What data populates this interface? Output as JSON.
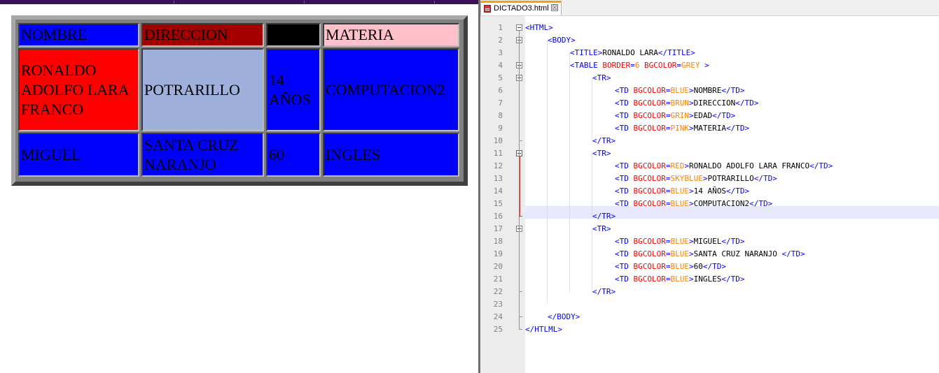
{
  "browser": {
    "table": {
      "rows": [
        [
          {
            "text": "NOMBRE",
            "bg": "#0000ff"
          },
          {
            "text": "DIRECCION",
            "bg": "#a50000"
          },
          {
            "text": "",
            "bg": "#000000"
          },
          {
            "text": "MATERIA",
            "bg": "#ffc0cb"
          }
        ],
        [
          {
            "text": "RONALDO ADOLFO LARA FRANCO",
            "bg": "#ff0000"
          },
          {
            "text": "POTRARILLO",
            "bg": "#9fb0dc"
          },
          {
            "text": "14 AÑOS",
            "bg": "#0000ff"
          },
          {
            "text": "COMPUTACION2",
            "bg": "#0000ff"
          }
        ],
        [
          {
            "text": "MIGUEL",
            "bg": "#0000ff"
          },
          {
            "text": "SANTA CRUZ NARANJO",
            "bg": "#0000ff"
          },
          {
            "text": "60",
            "bg": "#0000ff"
          },
          {
            "text": "INGLES",
            "bg": "#0000ff"
          }
        ]
      ]
    }
  },
  "editor": {
    "tab": {
      "label": "DICTADO3.html",
      "close": "☒"
    },
    "current_line": 16,
    "lines": [
      [
        [
          "tag",
          "<HTML>"
        ]
      ],
      [
        [
          "tag",
          "<BODY>"
        ]
      ],
      [
        [
          "tag",
          "<TITLE>"
        ],
        [
          "text",
          "RONALDO LARA"
        ],
        [
          "tag",
          "</TITLE>"
        ]
      ],
      [
        [
          "tag",
          "<TABLE "
        ],
        [
          "attr",
          "BORDER"
        ],
        [
          "tag",
          "="
        ],
        [
          "val",
          "6 "
        ],
        [
          "attr",
          "BGCOLOR"
        ],
        [
          "tag",
          "="
        ],
        [
          "val",
          "GREY "
        ],
        [
          "tag",
          ">"
        ]
      ],
      [
        [
          "tag",
          "<TR>"
        ]
      ],
      [
        [
          "tag",
          "<TD "
        ],
        [
          "attr",
          "BGCOLOR"
        ],
        [
          "tag",
          "="
        ],
        [
          "val",
          "BLUE"
        ],
        [
          "tag",
          ">"
        ],
        [
          "text",
          "NOMBRE"
        ],
        [
          "tag",
          "</TD>"
        ]
      ],
      [
        [
          "tag",
          "<TD "
        ],
        [
          "attr",
          "BGCOLOR"
        ],
        [
          "tag",
          "="
        ],
        [
          "val",
          "BRUN"
        ],
        [
          "tag",
          ">"
        ],
        [
          "text",
          "DIRECCION"
        ],
        [
          "tag",
          "</TD>"
        ]
      ],
      [
        [
          "tag",
          "<TD "
        ],
        [
          "attr",
          "BGCOLOR"
        ],
        [
          "tag",
          "="
        ],
        [
          "val",
          "GRIN"
        ],
        [
          "tag",
          ">"
        ],
        [
          "text",
          "EDAD"
        ],
        [
          "tag",
          "</TD>"
        ]
      ],
      [
        [
          "tag",
          "<TD "
        ],
        [
          "attr",
          "BGCOLOR"
        ],
        [
          "tag",
          "="
        ],
        [
          "val",
          "PINK"
        ],
        [
          "tag",
          ">"
        ],
        [
          "text",
          "MATERIA"
        ],
        [
          "tag",
          "</TD>"
        ]
      ],
      [
        [
          "tag",
          "</TR>"
        ]
      ],
      [
        [
          "tag",
          "<TR>"
        ]
      ],
      [
        [
          "tag",
          "<TD "
        ],
        [
          "attr",
          "BGCOLOR"
        ],
        [
          "tag",
          "="
        ],
        [
          "val",
          "RED"
        ],
        [
          "tag",
          ">"
        ],
        [
          "text",
          "RONALDO ADOLFO LARA FRANCO"
        ],
        [
          "tag",
          "</TD>"
        ]
      ],
      [
        [
          "tag",
          "<TD "
        ],
        [
          "attr",
          "BGCOLOR"
        ],
        [
          "tag",
          "="
        ],
        [
          "val",
          "SKYBLUE"
        ],
        [
          "tag",
          ">"
        ],
        [
          "text",
          "POTRARILLO"
        ],
        [
          "tag",
          "</TD>"
        ]
      ],
      [
        [
          "tag",
          "<TD "
        ],
        [
          "attr",
          "BGCOLOR"
        ],
        [
          "tag",
          "="
        ],
        [
          "val",
          "BLUE"
        ],
        [
          "tag",
          ">"
        ],
        [
          "text",
          "14 AÑOS"
        ],
        [
          "tag",
          "</TD>"
        ]
      ],
      [
        [
          "tag",
          "<TD "
        ],
        [
          "attr",
          "BGCOLOR"
        ],
        [
          "tag",
          "="
        ],
        [
          "val",
          "BLUE"
        ],
        [
          "tag",
          ">"
        ],
        [
          "text",
          "COMPUTACION2"
        ],
        [
          "tag",
          "</TD>"
        ]
      ],
      [
        [
          "tag",
          "</TR>"
        ]
      ],
      [
        [
          "tag",
          "<TR>"
        ]
      ],
      [
        [
          "tag",
          "<TD "
        ],
        [
          "attr",
          "BGCOLOR"
        ],
        [
          "tag",
          "="
        ],
        [
          "val",
          "BLUE"
        ],
        [
          "tag",
          ">"
        ],
        [
          "text",
          "MIGUEL"
        ],
        [
          "tag",
          "</TD>"
        ]
      ],
      [
        [
          "tag",
          "<TD "
        ],
        [
          "attr",
          "BGCOLOR"
        ],
        [
          "tag",
          "="
        ],
        [
          "val",
          "BLUE"
        ],
        [
          "tag",
          ">"
        ],
        [
          "text",
          "SANTA CRUZ NARANJO "
        ],
        [
          "tag",
          "</TD>"
        ]
      ],
      [
        [
          "tag",
          "<TD "
        ],
        [
          "attr",
          "BGCOLOR"
        ],
        [
          "tag",
          "="
        ],
        [
          "val",
          "BLUE"
        ],
        [
          "tag",
          ">"
        ],
        [
          "text",
          "60"
        ],
        [
          "tag",
          "</TD>"
        ]
      ],
      [
        [
          "tag",
          "<TD "
        ],
        [
          "attr",
          "BGCOLOR"
        ],
        [
          "tag",
          "="
        ],
        [
          "val",
          "BLUE"
        ],
        [
          "tag",
          ">"
        ],
        [
          "text",
          "INGLES"
        ],
        [
          "tag",
          "</TD>"
        ]
      ],
      [
        [
          "tag",
          "</TR>"
        ]
      ],
      [],
      [
        [
          "tag",
          "</BODY>"
        ]
      ],
      [
        [
          "tag",
          "</HTLML>"
        ]
      ]
    ]
  }
}
